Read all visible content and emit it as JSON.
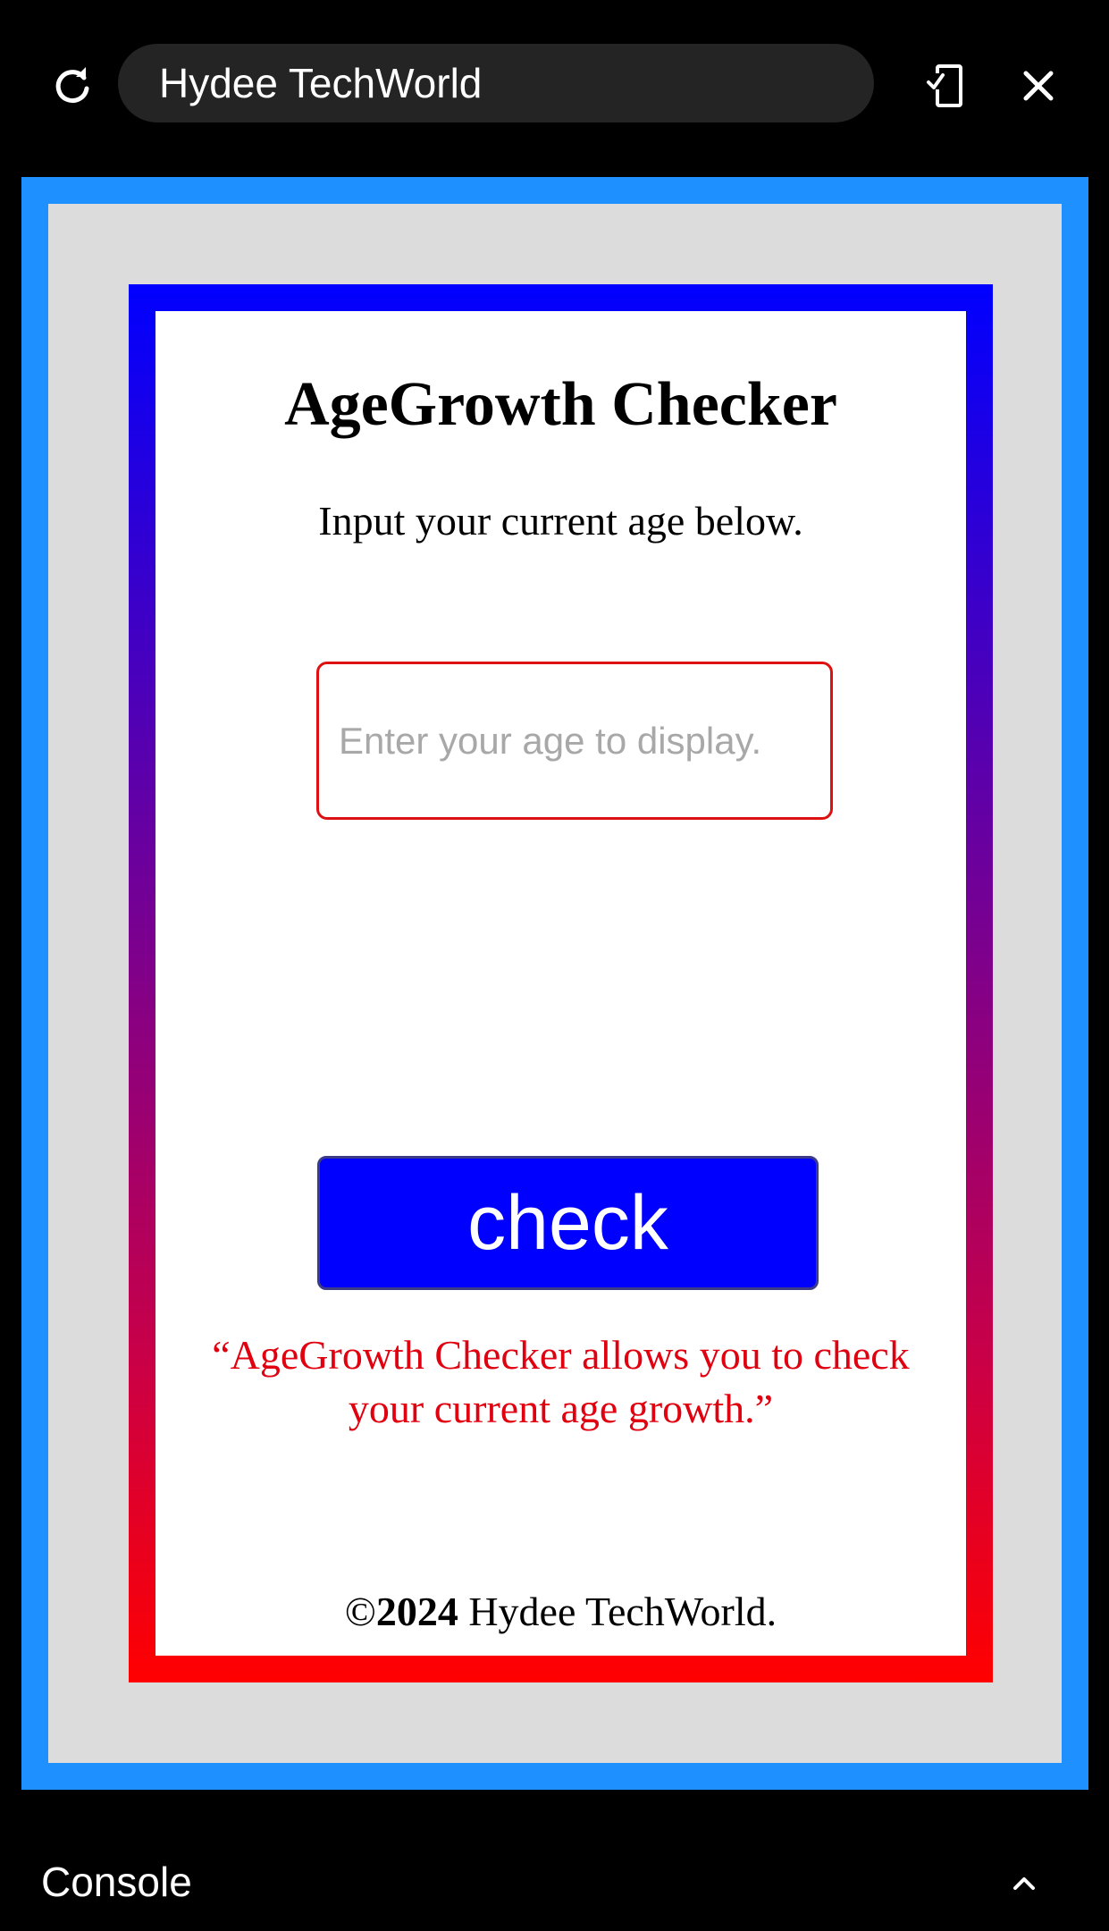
{
  "browser": {
    "address_text": "Hydee TechWorld",
    "icons": [
      "refresh-icon",
      "device-mode-icon",
      "close-icon"
    ]
  },
  "page": {
    "title": "AgeGrowth Checker",
    "subtitle": "Input your current age below.",
    "input": {
      "placeholder": "Enter your age to display.",
      "value": ""
    },
    "check_button_label": "check",
    "tagline": "“AgeGrowth Checker allows you to check your current age growth.”",
    "footer": {
      "copyright_symbol": "©",
      "year": "2024",
      "owner": " Hydee TechWorld."
    }
  },
  "console": {
    "label": "Console",
    "toggle_icon": "chevron-up-icon"
  },
  "colors": {
    "frame_blue": "#1e90ff",
    "page_background": "#dcdcdd",
    "gradient_top": "#0000ff",
    "gradient_bottom": "#ff0000",
    "button_blue": "#0000ff",
    "input_border_red": "#dd1111",
    "tagline_red": "#e00010"
  }
}
